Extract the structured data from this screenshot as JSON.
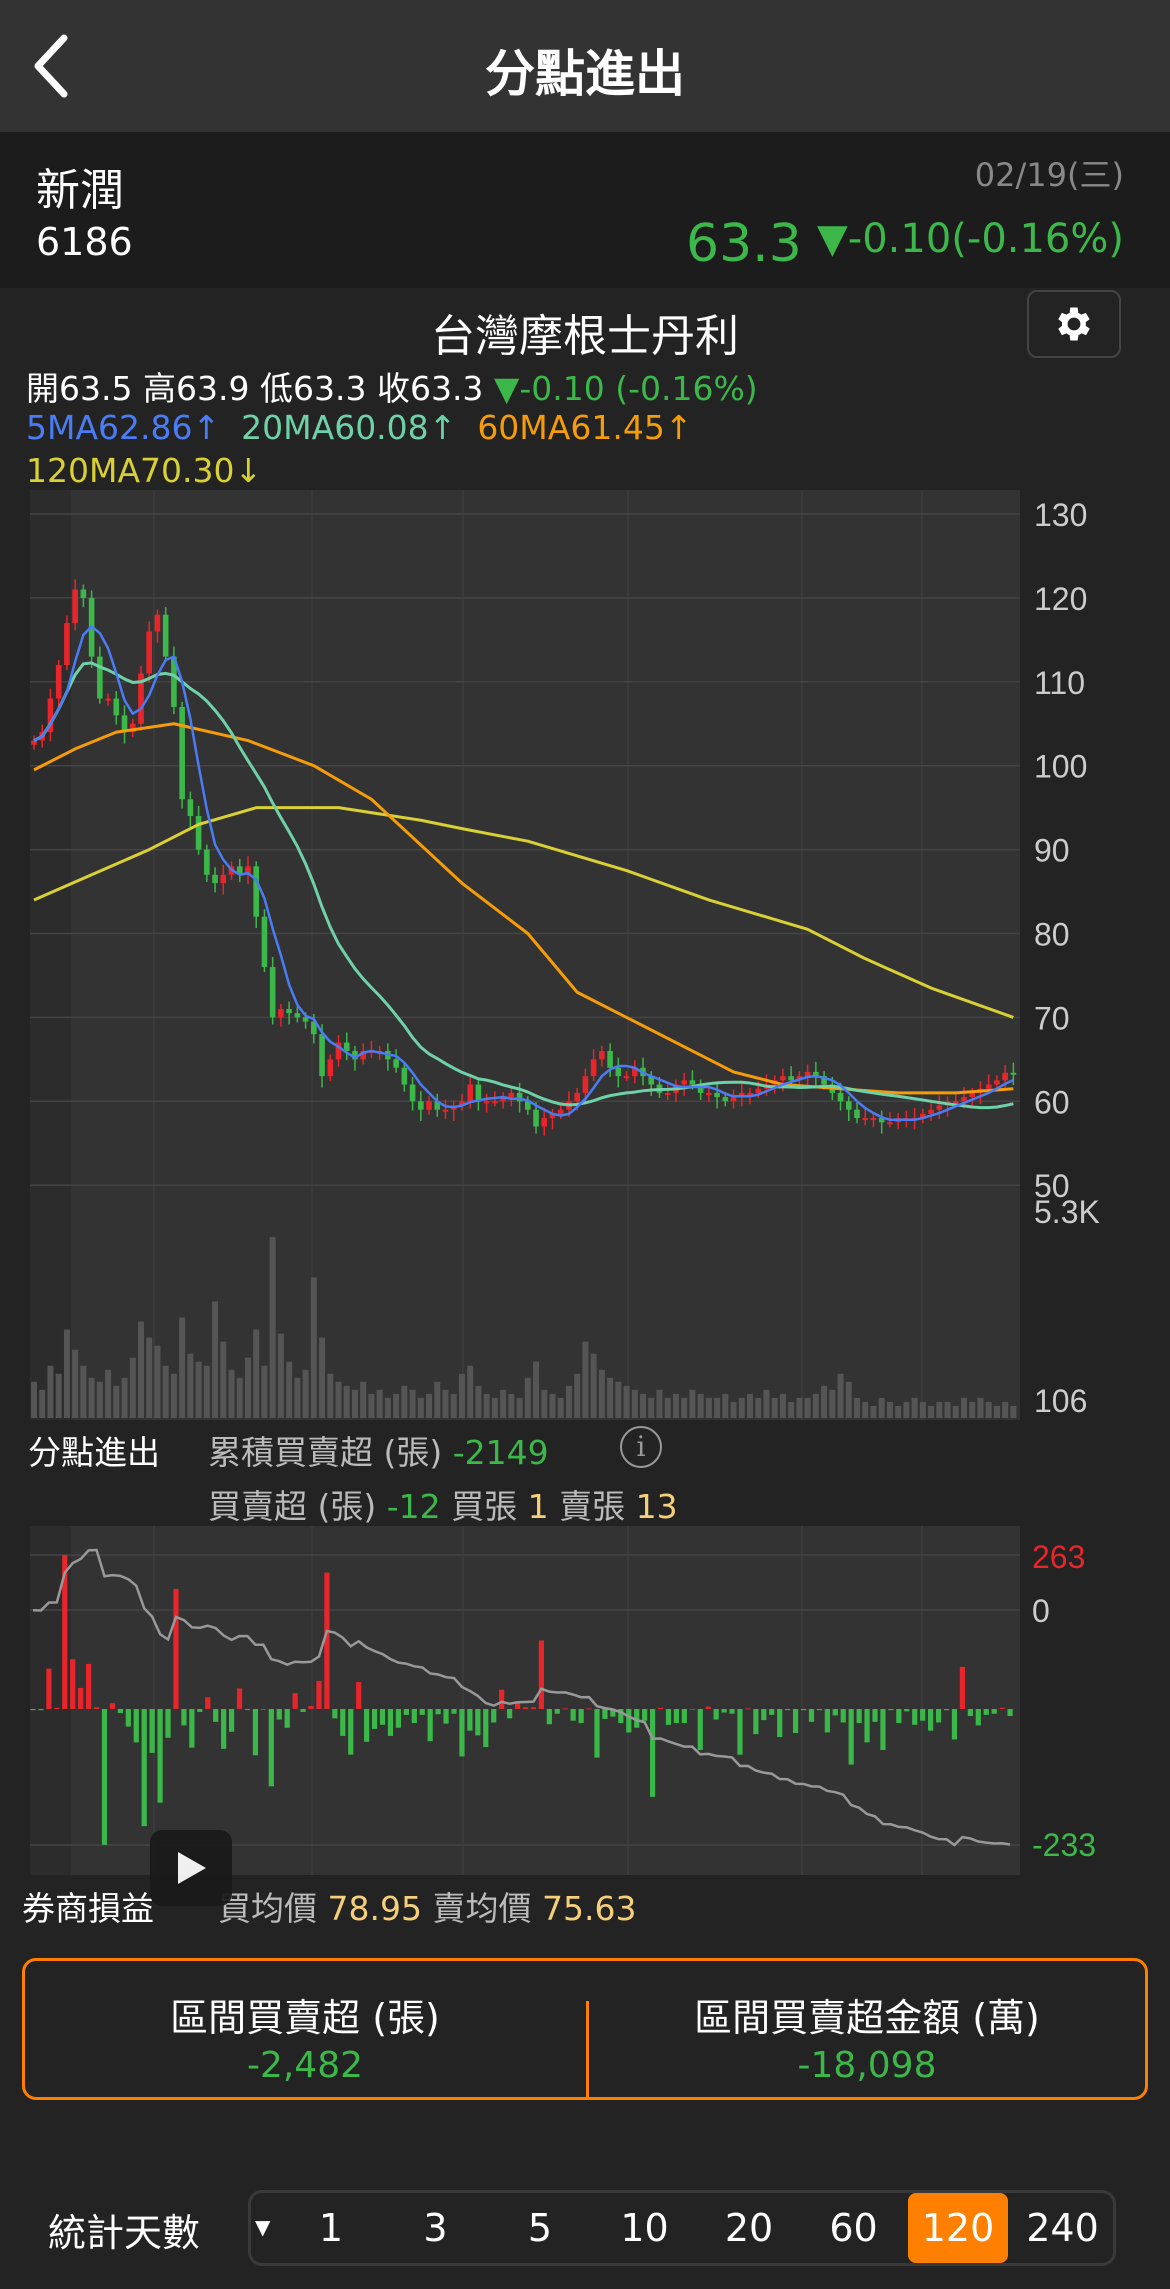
{
  "header": {
    "title": "分點進出",
    "back_icon": "chevron-left-icon"
  },
  "stock": {
    "name": "新潤",
    "code": "6186",
    "date": "02/19(三)",
    "price": "63.3",
    "change": "▼-0.10(-0.16%)"
  },
  "broker": {
    "name": "台灣摩根士丹利",
    "settings_icon": "gear-icon"
  },
  "ohlc": {
    "open_label": "開",
    "open": "63.5",
    "high_label": "高",
    "high": "63.9",
    "low_label": "低",
    "low": "63.3",
    "close_label": "收",
    "close": "63.3",
    "change": "▼-0.10 (-0.16%)"
  },
  "ma": {
    "ma5": "5MA62.86↑",
    "ma20": "20MA60.08↑",
    "ma60": "60MA61.45↑",
    "ma120": "120MA70.30↓"
  },
  "colors": {
    "up": "#e8252b",
    "down": "#3cb84a",
    "ma5": "#4a7cf5",
    "ma20": "#6fd1a8",
    "ma60": "#f59c0a",
    "ma120": "#d8d035",
    "accent": "#ff7f00"
  },
  "flow": {
    "title": "分點進出",
    "cum_label": "累積買賣超 (張)",
    "cum_value": "-2149",
    "day_label": "買賣超 (張)",
    "day_value": "-12",
    "buy_label": "買張",
    "buy_value": "1",
    "sell_label": "賣張",
    "sell_value": "13"
  },
  "pnl": {
    "title": "券商損益",
    "buy_avg_label": "買均價",
    "buy_avg": "78.95",
    "sell_avg_label": "賣均價",
    "sell_avg": "75.63"
  },
  "summary": {
    "net_label": "區間買賣超 (張)",
    "net_value": "-2,482",
    "amount_label": "區間買賣超金額 (萬)",
    "amount_value": "-18,098"
  },
  "period": {
    "label": "統計天數",
    "options": [
      "1",
      "3",
      "5",
      "10",
      "20",
      "60",
      "120",
      "240"
    ],
    "selected": "120"
  },
  "chart_data": [
    {
      "type": "candlestick",
      "y_ticks": [
        "130",
        "120",
        "110",
        "100",
        "90",
        "80",
        "70",
        "60",
        "50"
      ],
      "ylim": [
        50,
        130
      ],
      "close": [
        103,
        104,
        108,
        112,
        117,
        121,
        120,
        113,
        108,
        108,
        106,
        104,
        105,
        111,
        116,
        118,
        113,
        107,
        96,
        94,
        90,
        87,
        86,
        87,
        88,
        87,
        88,
        82,
        76,
        70,
        71,
        70.5,
        70,
        69.5,
        68,
        63,
        65,
        67,
        66,
        65,
        66,
        66,
        66,
        65,
        64,
        62,
        60,
        59,
        60,
        59,
        59,
        59.5,
        60,
        62,
        60,
        60,
        60,
        60.5,
        61,
        60,
        59,
        57,
        58,
        58.5,
        59,
        60,
        61,
        63,
        65,
        66,
        64,
        63,
        63,
        64,
        63,
        62,
        61,
        61,
        62,
        62.5,
        62,
        61,
        61,
        60.5,
        60,
        60.5,
        61,
        61,
        61.5,
        62,
        62.5,
        63,
        62.5,
        63,
        63.5,
        63,
        62,
        61,
        60,
        59,
        58,
        58,
        58,
        57.5,
        57.5,
        58,
        58,
        58,
        58.5,
        59,
        59.5,
        60,
        60,
        60.5,
        61,
        61.5,
        62,
        62.5,
        63.4,
        63.3
      ],
      "ma60": [
        [
          0,
          99.5
        ],
        [
          5,
          102
        ],
        [
          10,
          104
        ],
        [
          17,
          105
        ],
        [
          26,
          103
        ],
        [
          34,
          100
        ],
        [
          41,
          96
        ],
        [
          52,
          86
        ],
        [
          60,
          80
        ],
        [
          66,
          73
        ],
        [
          72,
          70
        ],
        [
          78,
          67
        ],
        [
          85,
          63.5
        ],
        [
          91,
          62
        ],
        [
          98,
          61.5
        ],
        [
          105,
          61
        ],
        [
          112,
          61
        ],
        [
          119,
          61.5
        ]
      ],
      "ma120": [
        [
          0,
          84
        ],
        [
          7,
          87
        ],
        [
          14,
          90
        ],
        [
          20,
          93
        ],
        [
          27,
          95
        ],
        [
          37,
          95
        ],
        [
          47,
          93.5
        ],
        [
          52,
          92.5
        ],
        [
          60,
          91
        ],
        [
          72,
          87.5
        ],
        [
          82,
          84
        ],
        [
          94,
          80.5
        ],
        [
          101,
          77
        ],
        [
          109,
          73.5
        ],
        [
          119,
          70
        ]
      ]
    },
    {
      "type": "bar",
      "name": "volume",
      "y_ticks": [
        "5.3K",
        "106"
      ],
      "ymax": 5300,
      "values": [
        900,
        700,
        1300,
        1100,
        2200,
        1700,
        1300,
        1000,
        900,
        1200,
        800,
        1000,
        1500,
        2400,
        2000,
        1800,
        1300,
        1100,
        2500,
        1600,
        1400,
        1300,
        2900,
        1900,
        1200,
        1000,
        1500,
        2200,
        1300,
        4500,
        2100,
        1400,
        1000,
        1200,
        3500,
        2000,
        1100,
        900,
        800,
        700,
        900,
        600,
        700,
        500,
        600,
        800,
        700,
        500,
        600,
        900,
        700,
        600,
        1100,
        1300,
        800,
        600,
        500,
        700,
        600,
        500,
        1000,
        1400,
        700,
        600,
        500,
        800,
        1100,
        1900,
        1600,
        1200,
        1000,
        900,
        800,
        700,
        600,
        500,
        700,
        500,
        600,
        500,
        700,
        600,
        500,
        500,
        600,
        400,
        500,
        600,
        500,
        700,
        500,
        600,
        400,
        500,
        500,
        600,
        800,
        700,
        1100,
        900,
        500,
        400,
        300,
        500,
        400,
        300,
        400,
        500,
        400,
        300,
        400,
        400,
        300,
        500,
        400,
        500,
        400,
        300,
        400,
        300
      ]
    },
    {
      "type": "bar",
      "name": "net_buy_sell",
      "y_ticks": [
        "263",
        "0",
        "-233"
      ],
      "ylim": [
        -233,
        263
      ],
      "values": [
        -2,
        -2,
        69,
        2,
        263,
        85,
        36,
        77,
        3,
        -232,
        10,
        -7,
        -30,
        -57,
        -200,
        -75,
        -160,
        -49,
        205,
        -28,
        -66,
        -5,
        20,
        -22,
        -68,
        -39,
        35,
        -1,
        -79,
        0,
        -132,
        -18,
        -32,
        27,
        -5,
        5,
        48,
        233,
        -16,
        -46,
        -78,
        46,
        -56,
        -34,
        -27,
        -46,
        -32,
        -10,
        -24,
        -10,
        -55,
        -9,
        -25,
        -8,
        -81,
        -37,
        -45,
        -65,
        -23,
        33,
        -16,
        13,
        3,
        3,
        117,
        -26,
        -8,
        1,
        -20,
        -24,
        1,
        -83,
        -17,
        -13,
        -24,
        -40,
        -32,
        -20,
        -150,
        2,
        -27,
        -24,
        -24,
        0,
        -70,
        4,
        -18,
        -6,
        -8,
        -78,
        1,
        -43,
        -19,
        -10,
        -48,
        -2,
        -41,
        -2,
        -22,
        -2,
        -40,
        -11,
        -23,
        -95,
        -24,
        -57,
        -22,
        -70,
        -2,
        -24,
        -4,
        -27,
        -20,
        -37,
        -23,
        -2,
        -52,
        72,
        -12,
        -28,
        -10,
        -8,
        2,
        -12
      ]
    }
  ]
}
